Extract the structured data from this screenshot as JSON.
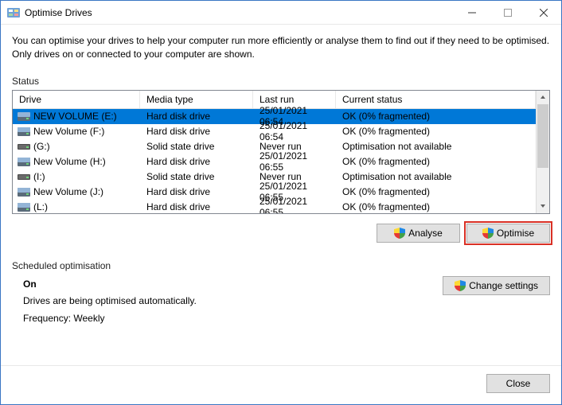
{
  "title": "Optimise Drives",
  "intro": "You can optimise your drives to help your computer run more efficiently or analyse them to find out if they need to be optimised. Only drives on or connected to your computer are shown.",
  "statusLabel": "Status",
  "columns": {
    "drive": "Drive",
    "media": "Media type",
    "last": "Last run",
    "status": "Current status"
  },
  "drives": [
    {
      "name": "NEW VOLUME (E:)",
      "media": "Hard disk drive",
      "last": "25/01/2021 06:54",
      "status": "OK (0% fragmented)",
      "selected": true,
      "type": "hdd"
    },
    {
      "name": "New Volume (F:)",
      "media": "Hard disk drive",
      "last": "25/01/2021 06:54",
      "status": "OK (0% fragmented)",
      "selected": false,
      "type": "hdd"
    },
    {
      "name": "(G:)",
      "media": "Solid state drive",
      "last": "Never run",
      "status": "Optimisation not available",
      "selected": false,
      "type": "ssd"
    },
    {
      "name": "New Volume (H:)",
      "media": "Hard disk drive",
      "last": "25/01/2021 06:55",
      "status": "OK (0% fragmented)",
      "selected": false,
      "type": "hdd"
    },
    {
      "name": "(I:)",
      "media": "Solid state drive",
      "last": "Never run",
      "status": "Optimisation not available",
      "selected": false,
      "type": "ssd"
    },
    {
      "name": "New Volume (J:)",
      "media": "Hard disk drive",
      "last": "25/01/2021 06:55",
      "status": "OK (0% fragmented)",
      "selected": false,
      "type": "hdd"
    },
    {
      "name": "(L:)",
      "media": "Hard disk drive",
      "last": "25/01/2021 06:55",
      "status": "OK (0% fragmented)",
      "selected": false,
      "type": "hdd"
    }
  ],
  "buttons": {
    "analyse": "Analyse",
    "optimise": "Optimise",
    "changeSettings": "Change settings",
    "close": "Close"
  },
  "sched": {
    "label": "Scheduled optimisation",
    "on": "On",
    "desc": "Drives are being optimised automatically.",
    "freq": "Frequency: Weekly"
  }
}
